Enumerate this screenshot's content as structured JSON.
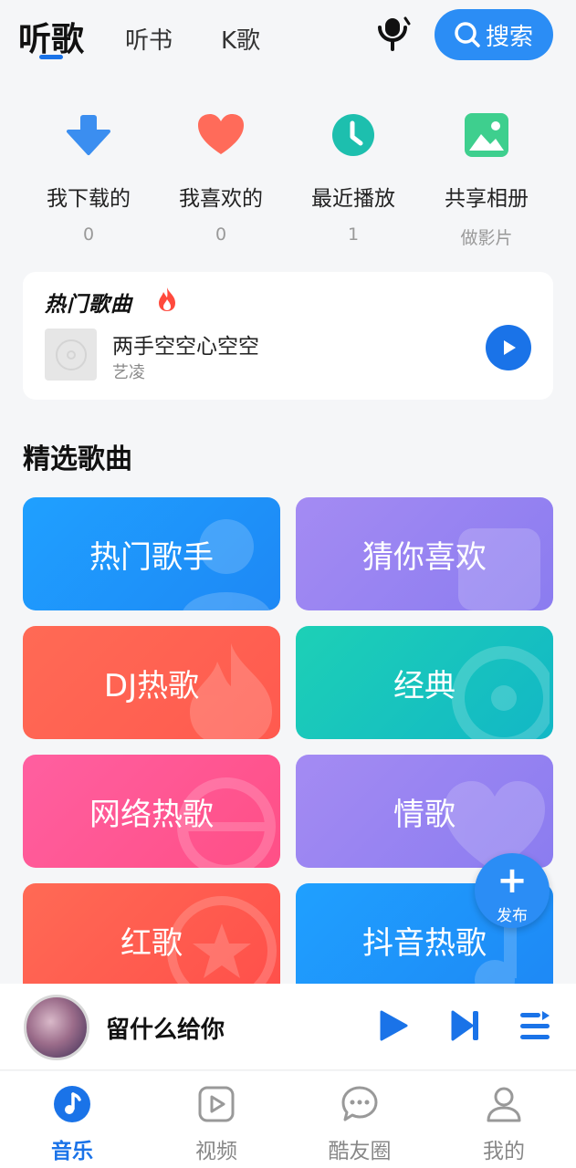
{
  "header": {
    "tabs": [
      {
        "label": "听歌",
        "active": true
      },
      {
        "label": "听书",
        "active": false
      },
      {
        "label": "K歌",
        "active": false
      }
    ],
    "search_label": "搜索"
  },
  "quick_access": [
    {
      "label": "我下载的",
      "count": "0",
      "icon": "download-icon",
      "color": "#3b8ef0"
    },
    {
      "label": "我喜欢的",
      "count": "0",
      "icon": "heart-icon",
      "color": "#ff6b5a"
    },
    {
      "label": "最近播放",
      "count": "1",
      "icon": "clock-icon",
      "color": "#1dbfae"
    },
    {
      "label": "共享相册",
      "count": "做影片",
      "icon": "photo-icon",
      "color": "#3ecf8e"
    }
  ],
  "hot_songs": {
    "title": "热门歌曲",
    "song": {
      "title": "两手空空心空空",
      "artist": "艺凌"
    }
  },
  "featured": {
    "title": "精选歌曲",
    "tiles": [
      {
        "label": "热门歌手",
        "color_from": "#1fa0ff",
        "color_to": "#1e88f5"
      },
      {
        "label": "猜你喜欢",
        "color_from": "#a48bf3",
        "color_to": "#8b7cf0"
      },
      {
        "label": "DJ热歌",
        "color_from": "#ff6a55",
        "color_to": "#ff5a4f"
      },
      {
        "label": "经典",
        "color_from": "#1dd0b6",
        "color_to": "#12b7c6"
      },
      {
        "label": "网络热歌",
        "color_from": "#ff5fa0",
        "color_to": "#ff4f86"
      },
      {
        "label": "情歌",
        "color_from": "#a48bf3",
        "color_to": "#8b7cf0"
      },
      {
        "label": "红歌",
        "color_from": "#ff6a55",
        "color_to": "#ff4f4a"
      },
      {
        "label": "抖音热歌",
        "color_from": "#1fa0ff",
        "color_to": "#1e88f5"
      }
    ]
  },
  "fab": {
    "label": "发布"
  },
  "player": {
    "title": "留什么给你"
  },
  "bottom_nav": [
    {
      "label": "音乐",
      "active": true
    },
    {
      "label": "视频",
      "active": false
    },
    {
      "label": "酷友圈",
      "active": false
    },
    {
      "label": "我的",
      "active": false
    }
  ],
  "accent_color": "#1a73e8"
}
